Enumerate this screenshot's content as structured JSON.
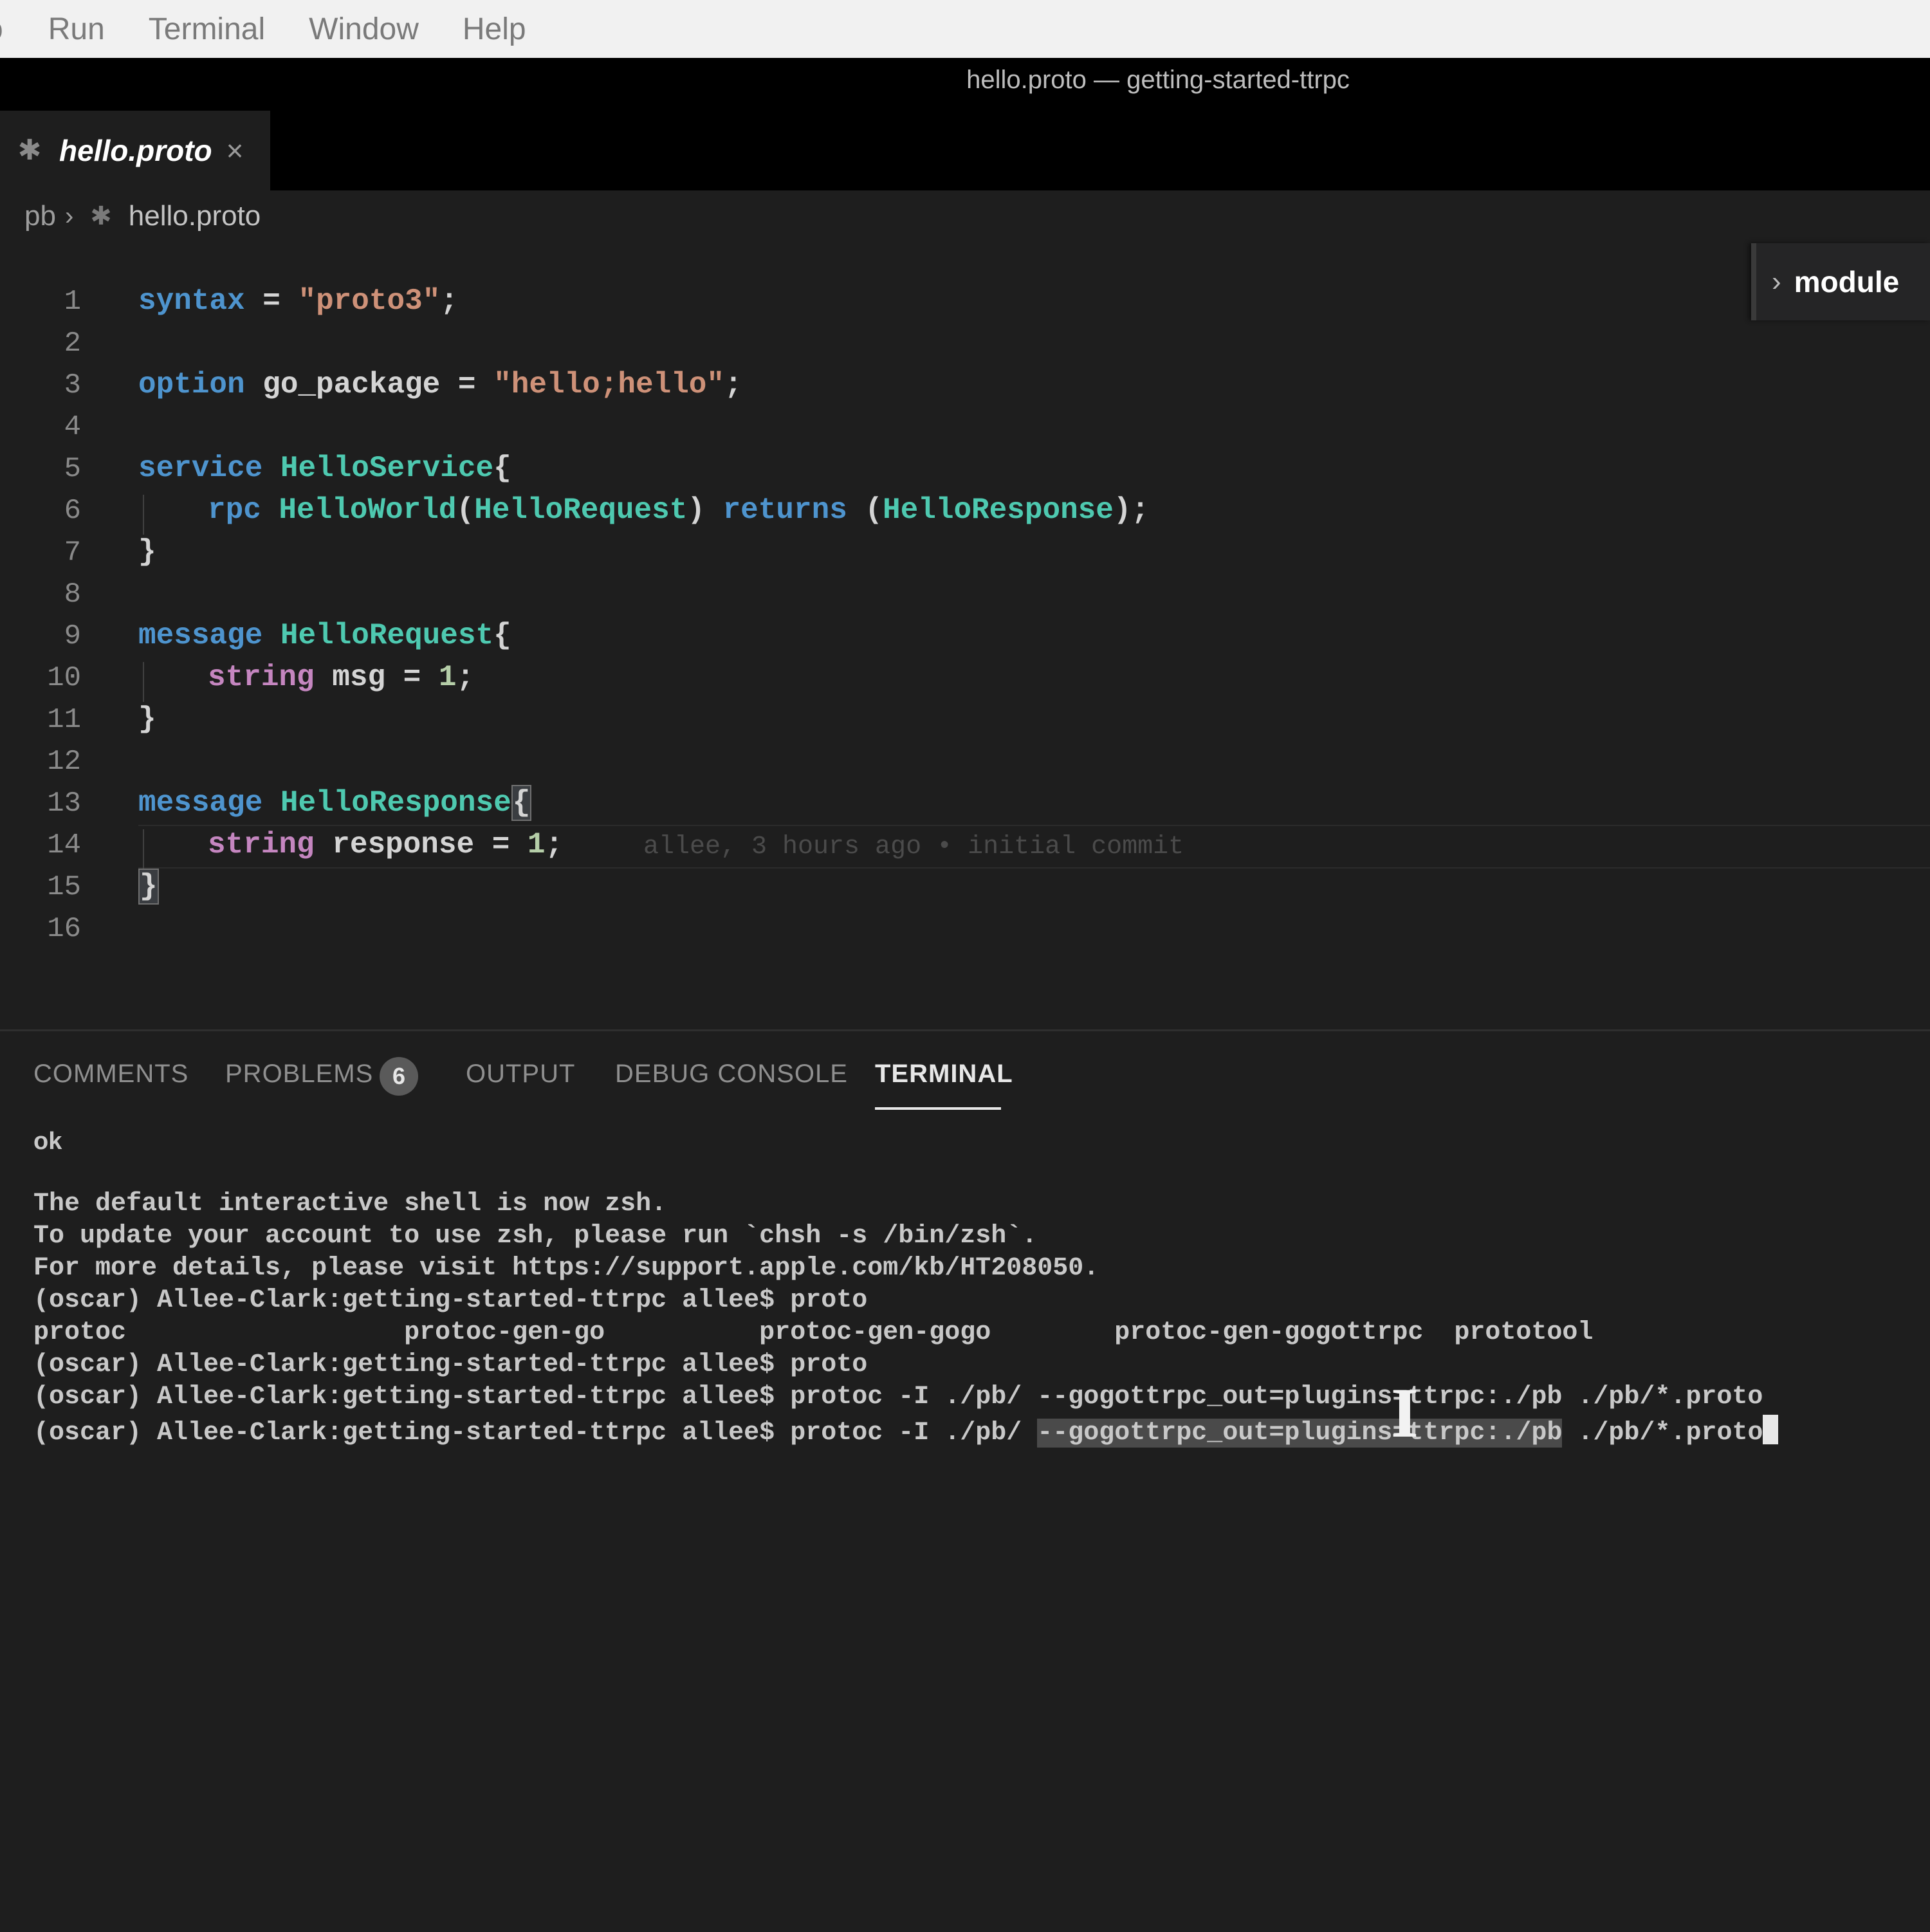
{
  "menubar": {
    "items": [
      "o",
      "Run",
      "Terminal",
      "Window",
      "Help"
    ]
  },
  "window": {
    "title": "hello.proto — getting-started-ttrpc"
  },
  "tabs": [
    {
      "label": "hello.proto",
      "close": "×",
      "icon": "proto-file-icon"
    }
  ],
  "breadcrumb": {
    "folder": "pb",
    "separator": "›",
    "file": "hello.proto"
  },
  "outline": {
    "label": "module"
  },
  "editor": {
    "line_numbers": [
      "1",
      "2",
      "3",
      "4",
      "5",
      "6",
      "7",
      "8",
      "9",
      "10",
      "11",
      "12",
      "13",
      "14",
      "15",
      "16"
    ],
    "current_line": 14,
    "blame": "allee, 3 hours ago • initial commit",
    "code": {
      "l1": {
        "kw": "syntax",
        "eq": " = ",
        "str": "\"proto3\"",
        "end": ";"
      },
      "l3": {
        "kw": "option",
        "name": " go_package",
        "eq": " = ",
        "str": "\"hello;hello\"",
        "end": ";"
      },
      "l5": {
        "kw": "service",
        "name": " HelloService",
        "open": "{"
      },
      "l6": {
        "kw": "rpc",
        "name": " HelloWorld",
        "p1": "(",
        "arg": "HelloRequest",
        "p2": ") ",
        "ret": "returns",
        "p3": " (",
        "res": "HelloResponse",
        "end": ");"
      },
      "l7": {
        "close": "}"
      },
      "l9": {
        "kw": "message",
        "name": " HelloRequest",
        "open": "{"
      },
      "l10": {
        "type": "string",
        "field": " msg",
        "eq": " = ",
        "num": "1",
        "end": ";"
      },
      "l11": {
        "close": "}"
      },
      "l13": {
        "kw": "message",
        "name": " HelloResponse",
        "open": "{"
      },
      "l14": {
        "type": "string",
        "field": " response",
        "eq": " = ",
        "num": "1",
        "end": ";"
      },
      "l15": {
        "close": "}"
      }
    }
  },
  "panel": {
    "tabs": [
      "COMMENTS",
      "PROBLEMS",
      "OUTPUT",
      "DEBUG CONSOLE",
      "TERMINAL"
    ],
    "problems_count": "6",
    "active_tab": "TERMINAL"
  },
  "terminal": {
    "ok": "ok",
    "lines": [
      "The default interactive shell is now zsh.",
      "To update your account to use zsh, please run `chsh -s /bin/zsh`.",
      "For more details, please visit https://support.apple.com/kb/HT208050.",
      "(oscar) Allee-Clark:getting-started-ttrpc allee$ proto",
      "protoc                  protoc-gen-go          protoc-gen-gogo        protoc-gen-gogottrpc  prototool",
      "(oscar) Allee-Clark:getting-started-ttrpc allee$ proto",
      "(oscar) Allee-Clark:getting-started-ttrpc allee$ protoc -I ./pb/ --gogottrpc_out=plugins=ttrpc:./pb ./pb/*.proto"
    ],
    "last_prefix": "(oscar) Allee-Clark:getting-started-ttrpc allee$ protoc -I ./pb/ ",
    "last_selected": "--gogottrpc_out=plugins=ttrpc:./pb",
    "last_suffix": " ./pb/*.proto"
  }
}
